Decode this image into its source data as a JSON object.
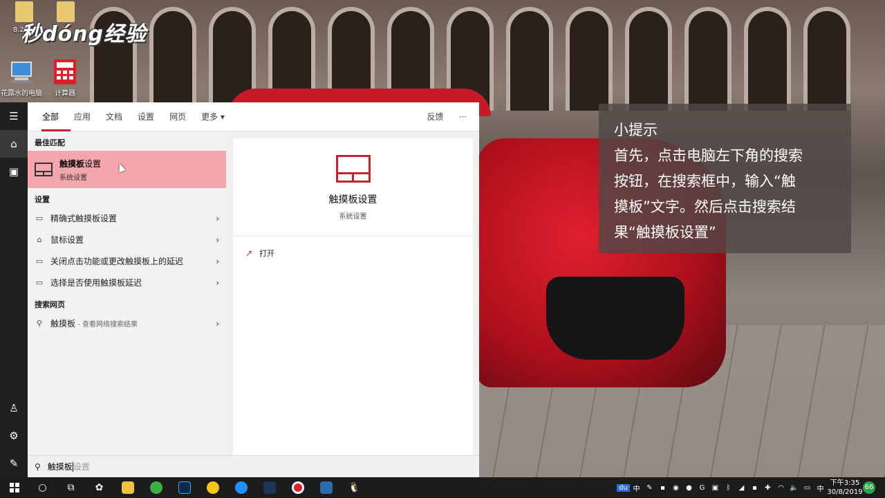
{
  "desktop": {
    "watermark": "秒dóng经验",
    "icons": [
      {
        "label": "8.29八"
      },
      {
        "label": "花露水的电脑"
      },
      {
        "label": "计算器"
      }
    ]
  },
  "rail": {
    "icons": [
      "hamburger-icon",
      "home-icon",
      "document-icon",
      "user-icon",
      "gear-icon",
      "feedback-icon"
    ]
  },
  "search": {
    "tabs": [
      "全部",
      "应用",
      "文档",
      "设置",
      "网页",
      "更多 ▾"
    ],
    "feedback": "反馈",
    "more": "···",
    "best_match_heading": "最佳匹配",
    "best": {
      "title_bold": "触摸板",
      "title_rest": "设置",
      "subtitle": "系统设置"
    },
    "settings_heading": "设置",
    "settings_items": [
      "精确式触摸板设置",
      "鼠标设置",
      "关闭点击功能或更改触摸板上的延迟",
      "选择是否使用触摸板延迟"
    ],
    "web_heading": "搜索网页",
    "web_item": {
      "query": "触摸板",
      "suffix": " - 查看网络搜索结果"
    },
    "preview": {
      "title": "触摸板设置",
      "subtitle": "系统设置",
      "open": "打开"
    },
    "query": "触摸板",
    "placeholder_rest": "设置"
  },
  "tip": {
    "heading": "小提示",
    "lines": [
      "首先，点击电脑左下角的搜索",
      "按钮，在搜索框中，输入“触",
      "摸板”文字。然后点击搜索结",
      "果“触摸板设置”"
    ]
  },
  "taskbar": {
    "time": "下午3:35",
    "date": "30/8/2019",
    "ime": "中",
    "badge": "66"
  }
}
